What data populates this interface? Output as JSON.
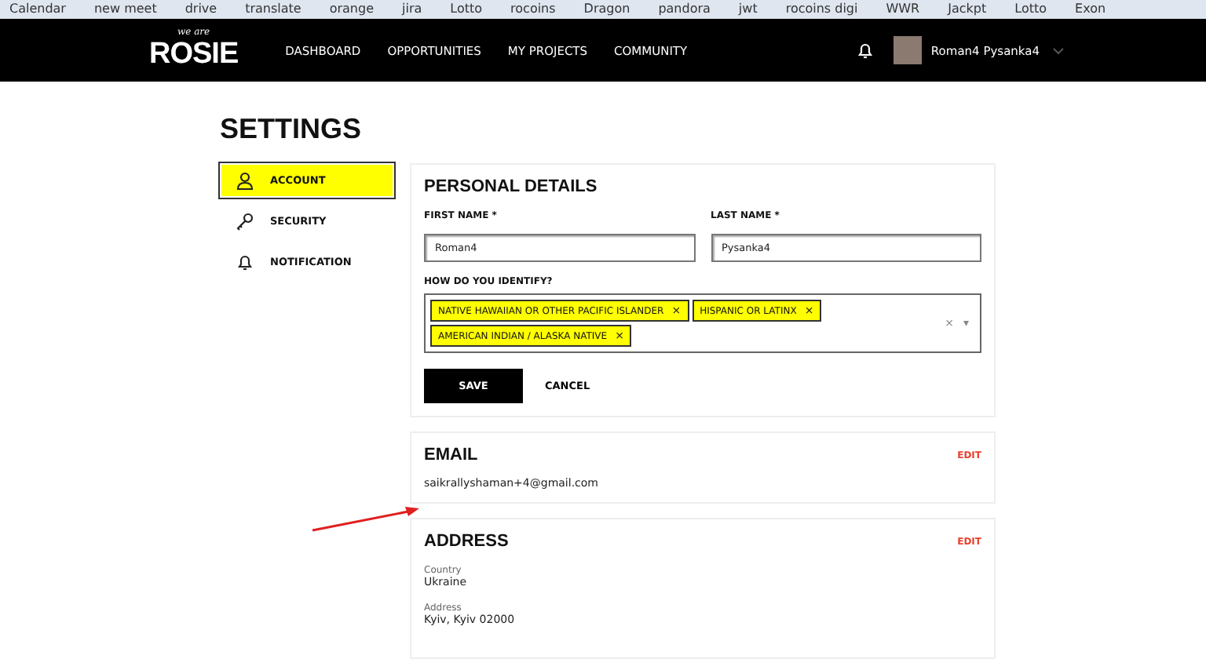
{
  "bookmarks": [
    "Calendar",
    "new meet",
    "drive",
    "translate",
    "orange",
    "jira",
    "Lotto",
    "rocoins",
    "Dragon",
    "pandora",
    "jwt",
    "rocoins digi",
    "WWR",
    "Jackpt",
    "Lotto",
    "Exon"
  ],
  "header": {
    "logo_tagline": "we are",
    "logo": "ROSIE",
    "nav": [
      {
        "label": "DASHBOARD"
      },
      {
        "label": "OPPORTUNITIES"
      },
      {
        "label": "MY PROJECTS"
      },
      {
        "label": "COMMUNITY"
      }
    ],
    "user_name": "Roman4 Pysanka4"
  },
  "page_title": "SETTINGS",
  "sidebar": [
    {
      "kind": "person",
      "label": "ACCOUNT",
      "selected": true
    },
    {
      "kind": "key",
      "label": "SECURITY",
      "selected": false
    },
    {
      "kind": "bell",
      "label": "NOTIFICATION",
      "selected": false
    }
  ],
  "personal": {
    "title": "PERSONAL DETAILS",
    "first_name": {
      "label": "FIRST NAME",
      "required": "*",
      "value": "Roman4"
    },
    "last_name": {
      "label": "LAST NAME",
      "required": "*",
      "value": "Pysanka4"
    },
    "identify_label": "HOW DO YOU IDENTIFY?",
    "tags": [
      {
        "label": "NATIVE HAWAIIAN OR OTHER PACIFIC ISLANDER",
        "remove": "×"
      },
      {
        "label": "HISPANIC OR LATINX",
        "remove": "×"
      },
      {
        "label": "AMERICAN INDIAN / ALASKA NATIVE",
        "remove": "×"
      }
    ],
    "clear": "×",
    "dropdown": "▾",
    "save": "SAVE",
    "cancel": "CANCEL"
  },
  "email": {
    "title": "EMAIL",
    "edit": "EDIT",
    "value": "saikrallyshaman+4@gmail.com"
  },
  "address": {
    "title": "ADDRESS",
    "edit": "EDIT",
    "fields": [
      {
        "label": "Country",
        "value": "Ukraine"
      },
      {
        "label": "Address",
        "value": "Kyiv, Kyiv 02000"
      }
    ]
  }
}
